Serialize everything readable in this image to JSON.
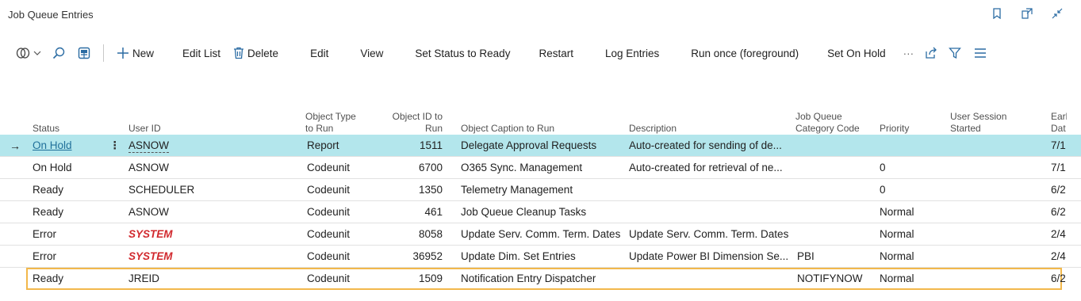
{
  "page": {
    "title": "Job Queue Entries"
  },
  "toolbar": {
    "new": "New",
    "edit_list": "Edit List",
    "delete": "Delete",
    "edit": "Edit",
    "view": "View",
    "set_status_ready": "Set Status to Ready",
    "restart": "Restart",
    "log_entries": "Log Entries",
    "run_once": "Run once (foreground)",
    "set_on_hold": "Set On Hold",
    "more": "···"
  },
  "columns": {
    "status": "Status",
    "user_id": "User ID",
    "object_type_1": "Object Type",
    "object_type_2": "to Run",
    "object_id_1": "Object ID to",
    "object_id_2": "Run",
    "caption": "Object Caption to Run",
    "description": "Description",
    "category_1": "Job Queue",
    "category_2": "Category Code",
    "priority": "Priority",
    "session_1": "User Session",
    "session_2": "Started",
    "earliest_1": "Earl",
    "earliest_2": "Dat"
  },
  "rows": [
    {
      "status": "On Hold",
      "user_id": "ASNOW",
      "object_type": "Report",
      "object_id": "1511",
      "caption": "Delegate Approval Requests",
      "description": "Auto-created for sending of de...",
      "category": "",
      "priority": "",
      "session": "",
      "earliest": "7/1"
    },
    {
      "status": "On Hold",
      "user_id": "ASNOW",
      "object_type": "Codeunit",
      "object_id": "6700",
      "caption": "O365 Sync. Management",
      "description": "Auto-created for retrieval of ne...",
      "category": "",
      "priority": "0",
      "session": "",
      "earliest": "7/1"
    },
    {
      "status": "Ready",
      "user_id": "SCHEDULER",
      "object_type": "Codeunit",
      "object_id": "1350",
      "caption": "Telemetry Management",
      "description": "",
      "category": "",
      "priority": "0",
      "session": "",
      "earliest": "6/2"
    },
    {
      "status": "Ready",
      "user_id": "ASNOW",
      "object_type": "Codeunit",
      "object_id": "461",
      "caption": "Job Queue Cleanup Tasks",
      "description": "",
      "category": "",
      "priority": "Normal",
      "session": "",
      "earliest": "6/2"
    },
    {
      "status": "Error",
      "user_id": "SYSTEM",
      "object_type": "Codeunit",
      "object_id": "8058",
      "caption": "Update Serv. Comm. Term. Dates",
      "description": "Update Serv. Comm. Term. Dates",
      "category": "",
      "priority": "Normal",
      "session": "",
      "earliest": "2/4"
    },
    {
      "status": "Error",
      "user_id": "SYSTEM",
      "object_type": "Codeunit",
      "object_id": "36952",
      "caption": "Update Dim. Set Entries",
      "description": "Update Power BI Dimension Se...",
      "category": "PBI",
      "priority": "Normal",
      "session": "",
      "earliest": "2/4"
    },
    {
      "status": "Ready",
      "user_id": "JREID",
      "object_type": "Codeunit",
      "object_id": "1509",
      "caption": "Notification Entry Dispatcher",
      "description": "",
      "category": "NOTIFYNOW",
      "priority": "Normal",
      "session": "",
      "earliest": "6/2"
    }
  ],
  "colors": {
    "accent": "#20709a",
    "selected_row": "#b3e6ec",
    "error_user": "#d1282d",
    "focus_outline": "#f2b84b"
  }
}
